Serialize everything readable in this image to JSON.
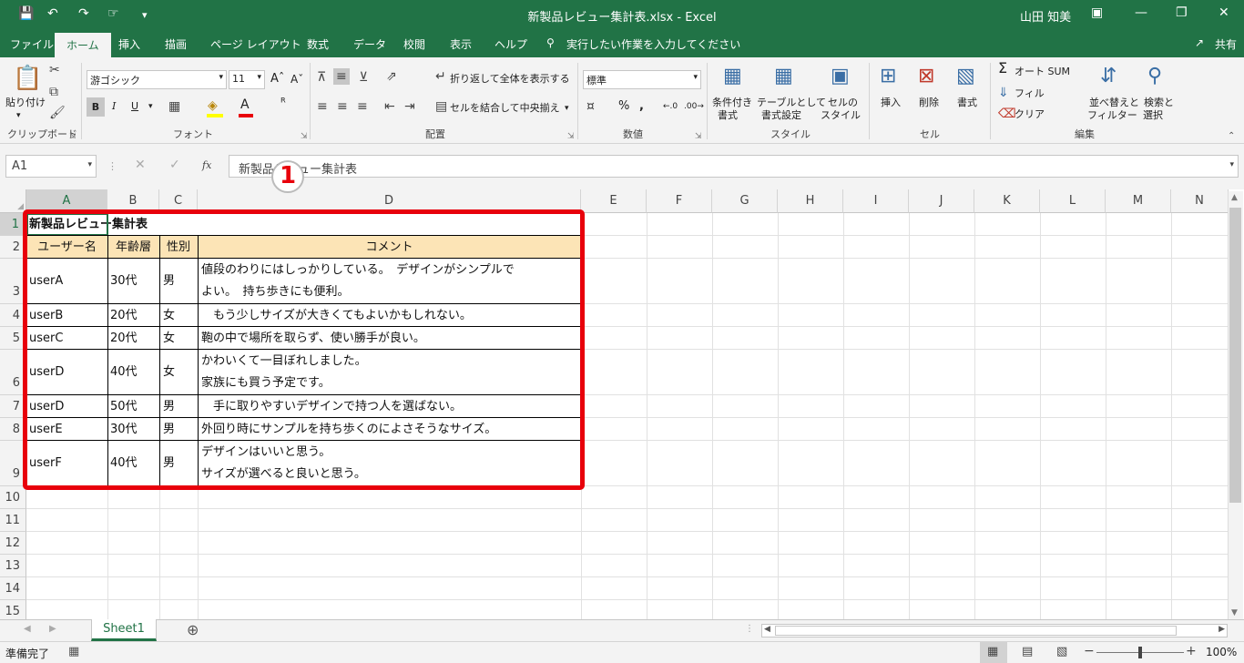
{
  "window": {
    "title": "新製品レビュー集計表.xlsx  -  Excel",
    "user": "山田 知美"
  },
  "tabs": [
    "ファイル",
    "ホーム",
    "挿入",
    "描画",
    "ページ レイアウト",
    "数式",
    "データ",
    "校閲",
    "表示",
    "ヘルプ"
  ],
  "tell_me": "実行したい作業を入力してください",
  "share": "共有",
  "ribbon": {
    "clipboard": {
      "group": "クリップボード",
      "paste": "貼り付け"
    },
    "font": {
      "group": "フォント",
      "name": "游ゴシック",
      "size": "11",
      "bold": "B",
      "italic": "I",
      "underline": "U"
    },
    "alignment": {
      "group": "配置",
      "wrap": "折り返して全体を表示する",
      "merge": "セルを結合して中央揃え"
    },
    "number": {
      "group": "数値",
      "format": "標準"
    },
    "styles": {
      "group": "スタイル",
      "conditional": [
        "条件付き",
        "書式"
      ],
      "table": [
        "テーブルとして",
        "書式設定"
      ],
      "cell_styles": [
        "セルの",
        "スタイル"
      ]
    },
    "cells": {
      "group": "セル",
      "insert": "挿入",
      "delete": "削除",
      "format": "書式"
    },
    "editing": {
      "group": "編集",
      "autosum": "オート SUM",
      "fill": "フィル",
      "clear": "クリア",
      "sort": [
        "並べ替えと",
        "フィルター"
      ],
      "find": [
        "検索と",
        "選択"
      ]
    }
  },
  "formula_bar": {
    "name_box": "A1",
    "content": "新製品レビュー集計表",
    "fx": "fx"
  },
  "columns": [
    "A",
    "B",
    "C",
    "D",
    "E",
    "F",
    "G",
    "H",
    "I",
    "J",
    "K",
    "L",
    "M",
    "N"
  ],
  "rows": [
    "1",
    "2",
    "3",
    "4",
    "5",
    "6",
    "7",
    "8",
    "9",
    "10",
    "11",
    "12",
    "13",
    "14",
    "15"
  ],
  "sheet": {
    "title": "新製品レビュー集計表",
    "headers": [
      "ユーザー名",
      "年齢層",
      "性別",
      "コメント"
    ],
    "records": [
      {
        "user": "userA",
        "age": "30代",
        "sex": "男",
        "c1": "値段のわりにはしっかりしている。　デザインがシンプルで",
        "c2": "よい。　持ち歩きにも便利。"
      },
      {
        "user": "userB",
        "age": "20代",
        "sex": "女",
        "c1": "　もう少しサイズが大きくてもよいかもしれない。",
        "c2": ""
      },
      {
        "user": "userC",
        "age": "20代",
        "sex": "女",
        "c1": "鞄の中で場所を取らず、使い勝手が良い。",
        "c2": ""
      },
      {
        "user": "userD",
        "age": "40代",
        "sex": "女",
        "c1": "かわいくて一目ぼれしました。",
        "c2": "家族にも買う予定です。"
      },
      {
        "user": "userD",
        "age": "50代",
        "sex": "男",
        "c1": "　手に取りやすいデザインで持つ人を選ばない。",
        "c2": ""
      },
      {
        "user": "userE",
        "age": "30代",
        "sex": "男",
        "c1": "外回り時にサンプルを持ち歩くのによさそうなサイズ。",
        "c2": ""
      },
      {
        "user": "userF",
        "age": "40代",
        "sex": "男",
        "c1": "デザインはいいと思う。",
        "c2": "サイズが選べると良いと思う。"
      }
    ]
  },
  "annotation": "1",
  "sheet_tab": "Sheet1",
  "status": {
    "ready": "準備完了",
    "zoom": "100%"
  },
  "colors": {
    "excel_green": "#217346",
    "highlight_red": "#e8000b",
    "header_fill": "#fce4b6"
  }
}
